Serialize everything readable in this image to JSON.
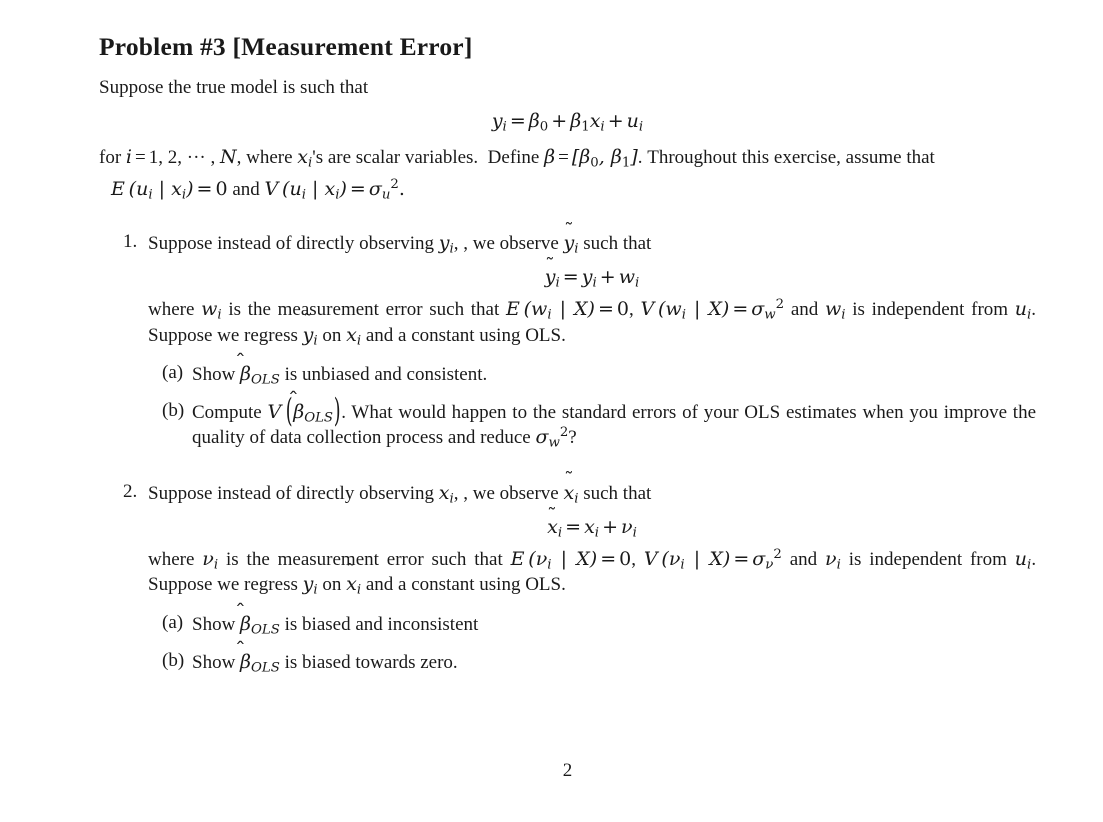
{
  "document": {
    "title": "Problem #3 [Measurement Error]",
    "intro_line": "Suppose the true model is such that",
    "model_equation": "y_i = β_0 + β_1 x_i + u_i",
    "intro_continued": "for i = 1, 2, ··· , N, where x_i's are scalar variables.  Define β = [β_0, β_1].  Throughout this exercise, assume that",
    "assumption_equation": "E (u_i | x_i) = 0 and V (u_i | x_i) = σ_u^2.",
    "page_number": "2",
    "items": [
      {
        "marker": "1.",
        "stem": "Suppose instead of directly observing y_i, we observe ỹ_i such that",
        "display_equation": "ỹ_i = y_i + w_i",
        "explanation": "where w_i is the measurement error such that E (w_i | X) = 0, V (w_i | X) = σ_w^2 and w_i is independent from u_i. Suppose we regress ỹ_i on x_i and a constant using OLS.",
        "subitems": [
          {
            "marker": "(a)",
            "text": "Show β̂_OLS is unbiased and consistent."
          },
          {
            "marker": "(b)",
            "text": "Compute V (β̂_OLS).  What would happen to the standard errors of your OLS estimates when you improve the quality of data collection process and reduce σ_w^2?"
          }
        ]
      },
      {
        "marker": "2.",
        "stem": "Suppose instead of directly observing x_i, we observe x̃_i such that",
        "display_equation": "x̃_i = x_i + ν_i",
        "explanation": "where ν_i is the measurement error such that E (ν_i | X) = 0, V (ν_i | X) = σ_ν^2 and ν_i is independent from u_i. Suppose we regress y_i on x̃_i and a constant using OLS.",
        "subitems": [
          {
            "marker": "(a)",
            "text": "Show β̂_OLS is biased and inconsistent"
          },
          {
            "marker": "(b)",
            "text": "Show β̂_OLS is biased towards zero."
          }
        ]
      }
    ],
    "fragments": {
      "intro_c1": "for",
      "intro_c2": ", where",
      "intro_c3": "'s are scalar variables.",
      "intro_c4": "Define",
      "intro_c5": ".  Throughout this exercise, assume that",
      "assump_and": "and",
      "i1_stem_a": "Suppose instead of directly observing",
      "i1_stem_b": ", we observe",
      "i1_stem_c": "such that",
      "i1_exp_a": "where",
      "i1_exp_b": "is the measurement error such that",
      "i1_exp_c": "and",
      "i1_exp_d": "is independent from",
      "i1_exp_e": ". Suppose we regress",
      "i1_exp_f": "on",
      "i1_exp_g": "and a constant using OLS.",
      "i1a_a": "Show",
      "i1a_b": "is unbiased and consistent.",
      "i1b_a": "Compute",
      "i1b_b": ".  What would happen to the standard errors of your OLS estimates when you improve the quality of data collection process and reduce",
      "i1b_c": "?",
      "i2a_b": "is biased and inconsistent",
      "i2b_b": "is biased towards zero."
    }
  }
}
